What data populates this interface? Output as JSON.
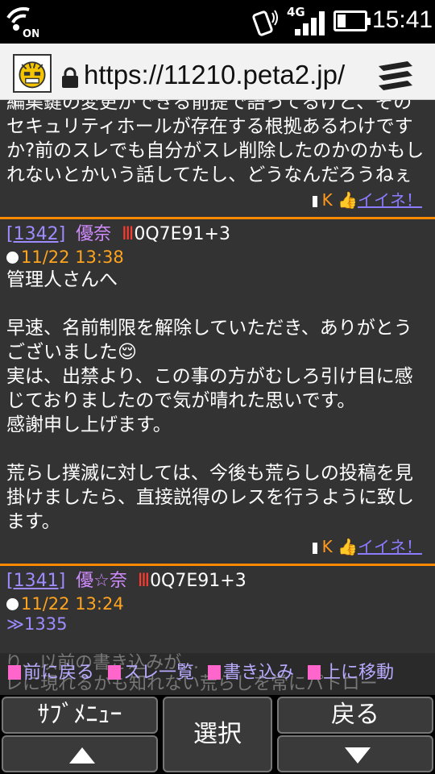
{
  "status_bar": {
    "nfc_label": "ON",
    "network": "4G",
    "time": "15:41"
  },
  "browser": {
    "url": "https://11210.peta2.jp/",
    "favicon": "angry-face-icon",
    "menu_icon": "menu-icon"
  },
  "colors": {
    "accent": "#ff8a00",
    "link": "#9c8cff",
    "name": "#d08bff",
    "date": "#ffa41e",
    "background": "#333333"
  },
  "posts": {
    "prev": {
      "text": "編集鍵の変更ができる前提で語ってるけど、そのセキュリティホールが存在する根拠あるわけですか?前のスレでも自分がスレ削除したのかのかもしれないとかいう話してたし、どうなんだろうねぇ",
      "reply_k": "K",
      "nice": "イイネ！"
    },
    "p1342": {
      "number": "[1342]",
      "name": "優奈",
      "id": "0Q7E91+3",
      "date": "11/22 13:38",
      "text_1": "管理人さんへ",
      "text_2": "早速、名前制限を解除していただき、ありがとうございました",
      "text_3": "実は、出禁より、この事の方がむしろ引け目に感じておりましたので気が晴れた思いです。\n感謝申し上げます。",
      "text_4": "荒らし撲滅に対しては、今後も荒らしの投稿を見掛けましたら、直接説得のレスを行うように致します。",
      "reply_k": "K",
      "nice": "イイネ！"
    },
    "p1341": {
      "number": "[1341]",
      "name": "優☆奈",
      "id": "0Q7E91+3",
      "date": "11/22 13:24",
      "anchor": "≫1335"
    }
  },
  "footer_nav": {
    "prev": "前に戻る",
    "thread": "スレ一覧",
    "write": "書き込み",
    "top": "上に移動",
    "ghost_1": "り、以前の書き込みが…",
    "ghost_2": "レに現れるかも知れない荒らしを常にパトロー"
  },
  "softkeys": {
    "submenu": "ｻﾌﾞﾒﾆｭｰ",
    "select": "選択",
    "back": "戻る"
  }
}
